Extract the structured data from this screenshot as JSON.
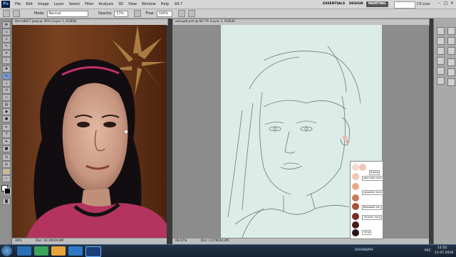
{
  "menubar": {
    "logo": "Ps",
    "items": [
      "File",
      "Edit",
      "Image",
      "Layer",
      "Select",
      "Filter",
      "Analysis",
      "3D",
      "View",
      "Window",
      "Help"
    ],
    "zoom": "66.7",
    "workspaces": [
      "ESSENTIALS",
      "DESIGN",
      "PAINTING"
    ],
    "active_workspace": "PAINTING",
    "cs_live": "CS Live",
    "window_controls": [
      "–",
      "□",
      "×"
    ]
  },
  "options": {
    "mode_label": "Mode:",
    "mode_value": "Normal",
    "opacity_label": "Opacity:",
    "opacity_value": "57%",
    "flow_label": "Flow:",
    "flow_value": "100%"
  },
  "documents": {
    "photo_tab": "Фото8627.jpeg @ 30% (Layer 1, RGB/8)",
    "sketch_tab": "вокщий.psd @ 66.7% (Layer 1, RGB/8)",
    "photo_zoom": "30%",
    "photo_doc": "Doc: 16.1M/29.8M",
    "sketch_zoom": "66.67%",
    "sketch_doc": "Doc: 2.07M/42.2M"
  },
  "palette": {
    "labels": [
      "блики",
      "светлые тона",
      "средние тона",
      "базовый тон",
      "теплые тона",
      "тени"
    ],
    "colors": [
      "#f7d8d2",
      "#f2c7b5",
      "#e8a98a",
      "#c7795c",
      "#a95338",
      "#7a2d22",
      "#4e1a16",
      "#2a1412"
    ]
  },
  "taskbar": {
    "language": "РУС",
    "time": "11:52",
    "date": "11.07.2016"
  },
  "watermark": "SOGRAPH"
}
